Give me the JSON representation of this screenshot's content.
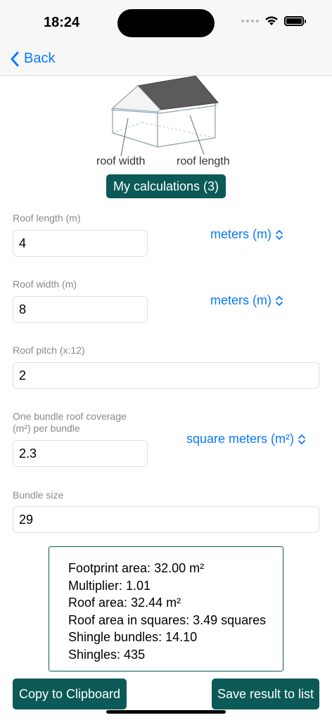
{
  "status_bar": {
    "time": "18:24"
  },
  "nav": {
    "back_label": "Back"
  },
  "diagram": {
    "width_label": "roof width",
    "length_label": "roof length"
  },
  "calculations_button": "My calculations (3)",
  "fields": {
    "roof_length": {
      "label": "Roof length (m)",
      "value": "4",
      "unit": "meters (m)"
    },
    "roof_width": {
      "label": "Roof width (m)",
      "value": "8",
      "unit": "meters (m)"
    },
    "roof_pitch": {
      "label": "Roof pitch (x:12)",
      "value": "2"
    },
    "bundle_coverage": {
      "label_line1": "One bundle roof coverage",
      "label_line2": "(m²) per bundle",
      "value": "2.3",
      "unit": "square meters (m²)"
    },
    "bundle_size": {
      "label": "Bundle size",
      "value": "29"
    }
  },
  "results": {
    "footprint": "Footprint area: 32.00 m²",
    "multiplier": "Multiplier: 1.01",
    "roof_area": "Roof area: 32.44 m²",
    "roof_area_squares": "Roof area in squares: 3.49 squares",
    "shingle_bundles": "Shingle bundles: 14.10",
    "shingles": "Shingles: 435"
  },
  "actions": {
    "copy": "Copy to Clipboard",
    "save": "Save result to list"
  },
  "colors": {
    "accent": "#0a7aff",
    "brand": "#0b5a58"
  }
}
